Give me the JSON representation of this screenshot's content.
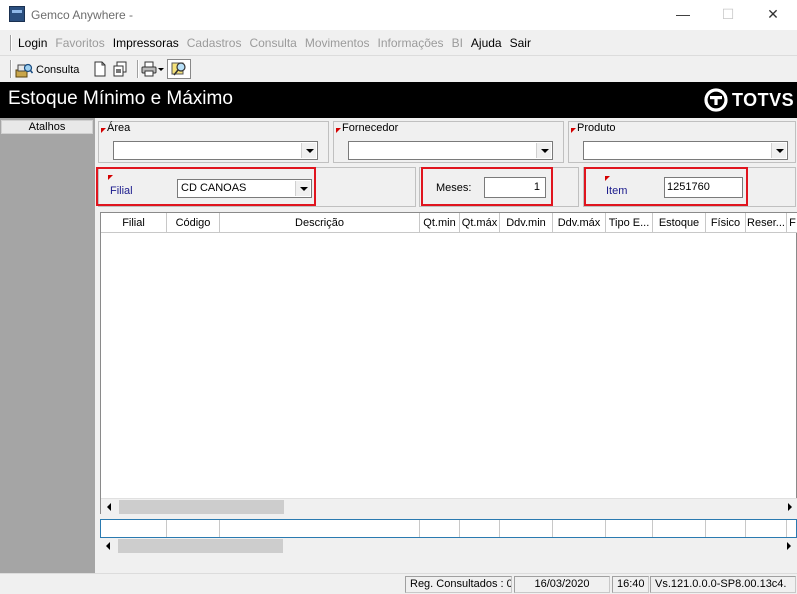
{
  "window": {
    "title": "Gemco Anywhere -",
    "minimize": "—",
    "maximize": "☐",
    "close": "✕"
  },
  "menu": {
    "items": [
      {
        "label": "Login",
        "enabled": true
      },
      {
        "label": "Favoritos",
        "enabled": false
      },
      {
        "label": "Impressoras",
        "enabled": true
      },
      {
        "label": "Cadastros",
        "enabled": false
      },
      {
        "label": "Consulta",
        "enabled": false
      },
      {
        "label": "Movimentos",
        "enabled": false
      },
      {
        "label": "Informações",
        "enabled": false
      },
      {
        "label": "BI",
        "enabled": false
      },
      {
        "label": "Ajuda",
        "enabled": true
      },
      {
        "label": "Sair",
        "enabled": true
      }
    ]
  },
  "toolbar": {
    "consulta_label": "Consulta",
    "icons": [
      "consulta-icon",
      "new-document-icon",
      "copy-document-icon",
      "print-icon",
      "dropdown-arrow-icon",
      "search-icon"
    ]
  },
  "header": {
    "title": "Estoque Mínimo e Máximo",
    "logo_text": "TOTVS"
  },
  "sidebar": {
    "atalhos_label": "Atalhos"
  },
  "filters": {
    "area": {
      "label": "Área",
      "value": ""
    },
    "fornecedor": {
      "label": "Fornecedor",
      "value": ""
    },
    "produto": {
      "label": "Produto",
      "value": ""
    },
    "filial": {
      "label": "Filial",
      "value": "CD CANOAS"
    },
    "meses": {
      "label": "Meses:",
      "value": "1"
    },
    "item": {
      "label": "Item",
      "value": "1251760"
    }
  },
  "grid": {
    "columns": [
      "Filial",
      "Código",
      "Descrição",
      "Qt.min",
      "Qt.máx",
      "Ddv.min",
      "Ddv.máx",
      "Tipo E...",
      "Estoque",
      "Físico",
      "Reser...",
      "F"
    ],
    "rows": []
  },
  "status": {
    "reg_consultados": "Reg. Consultados : 0",
    "date": "16/03/2020",
    "time": "16:40",
    "version": "Vs.121.0.0.0-SP8.00.13c4."
  },
  "colors": {
    "highlight_border": "#e0141e",
    "header_bg": "#000000",
    "sidebar_bg": "#a5a5a5",
    "required_marker": "#d40000",
    "label_blue": "#1a1a8c"
  }
}
